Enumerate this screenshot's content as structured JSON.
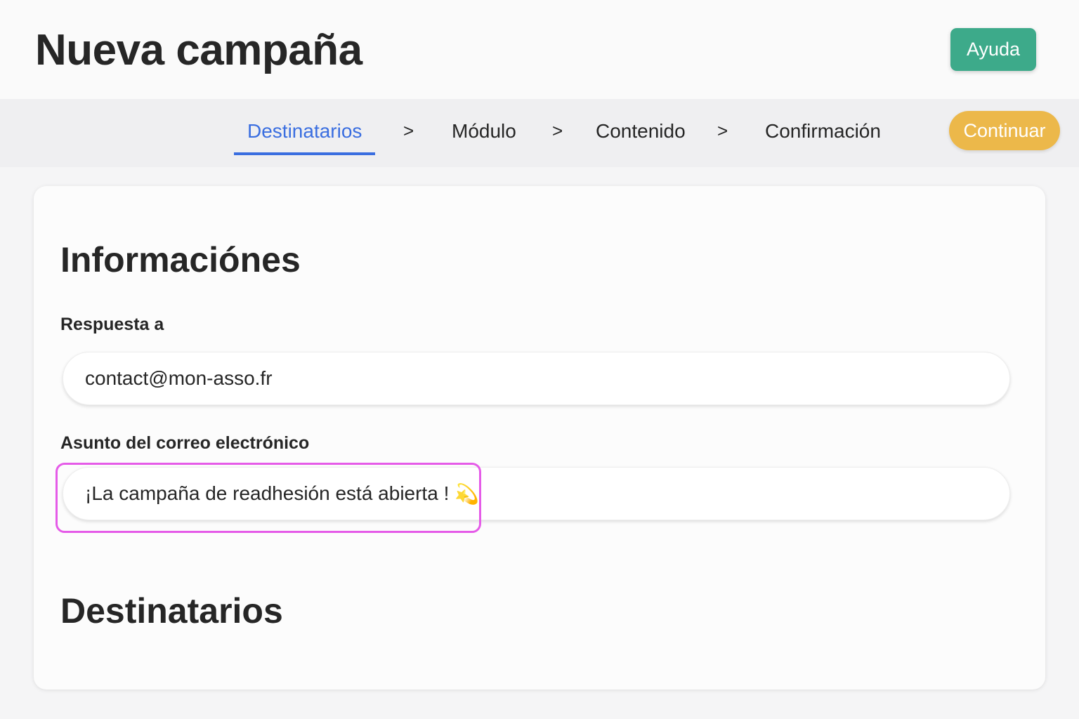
{
  "header": {
    "title": "Nueva campaña",
    "help_label": "Ayuda"
  },
  "stepper": {
    "steps": [
      {
        "label": "Destinatarios",
        "active": true
      },
      {
        "label": "Módulo",
        "active": false
      },
      {
        "label": "Contenido",
        "active": false
      },
      {
        "label": "Confirmación",
        "active": false
      }
    ],
    "separator": ">",
    "continue_label": "Continuar"
  },
  "form": {
    "section_info_title": "Informaciónes",
    "reply_to": {
      "label": "Respuesta a",
      "value": "contact@mon-asso.fr"
    },
    "subject": {
      "label": "Asunto del correo electrónico",
      "value": "¡La campaña de readhesión está abierta !",
      "icon": "comet-icon"
    },
    "section_recipients_title": "Destinatarios"
  },
  "colors": {
    "help_button": "#3daa8a",
    "continue_button": "#ecb84a",
    "active_step": "#3a6ee0",
    "highlight": "#e55be8"
  }
}
